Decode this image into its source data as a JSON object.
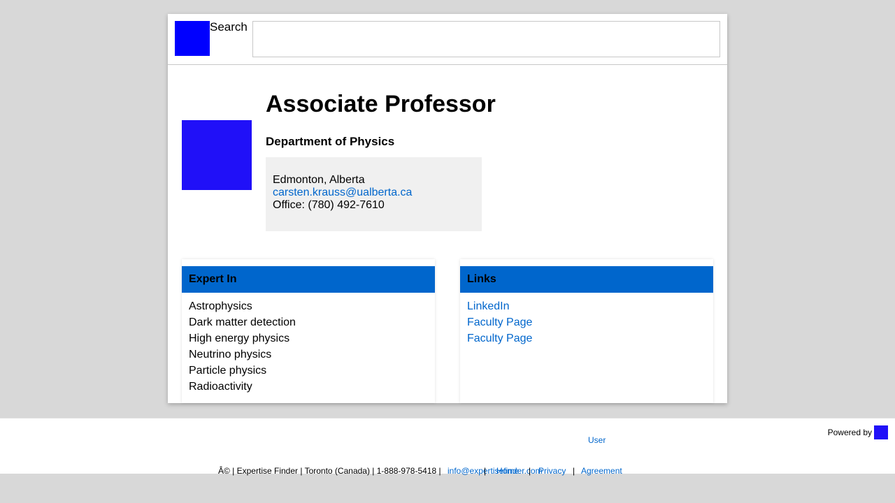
{
  "header": {
    "search_label": "Search",
    "search_value": "",
    "search_placeholder": ""
  },
  "profile": {
    "title": "Associate Professor",
    "department": "Department of Physics",
    "location": "Edmonton, Alberta",
    "email": "carsten.krauss@ualberta.ca",
    "office": "Office: (780) 492-7610"
  },
  "expert_in": {
    "heading": "Expert In",
    "items": [
      "Astrophysics",
      "Dark matter detection",
      "High energy physics",
      "Neutrino physics",
      "Particle physics",
      "Radioactivity"
    ]
  },
  "links": {
    "heading": "Links",
    "items": [
      "LinkedIn",
      "Faculty Page",
      "Faculty Page"
    ]
  },
  "footer": {
    "powered_by": "Powered by",
    "user_label": "User",
    "copyright_text": "Â© | Expertise Finder | Toronto (Canada) | 1-888-978-5418 |",
    "email_link": "info@expertisefinder.com",
    "sep1": "|",
    "home_label": "Home",
    "sep2": "|",
    "privacy_label": "Privacy",
    "sep3": "|",
    "agreement_label": "Agreement"
  },
  "colors": {
    "accent": "#0066cc",
    "logo_blue": "#0000ff",
    "avatar_blue": "#2010f8",
    "background": "#d8d8d8"
  }
}
